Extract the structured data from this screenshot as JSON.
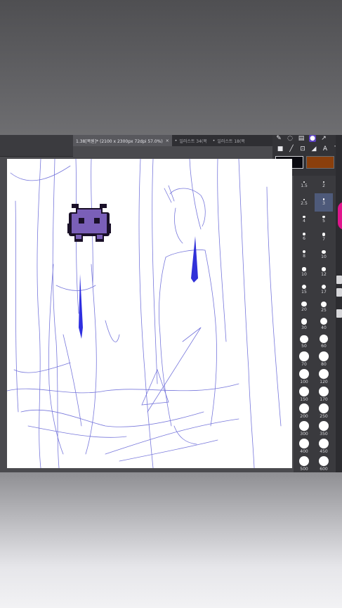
{
  "tabs": [
    {
      "label": "1.38[복원]* (2100 x 2300px 72dpi 57.0%)",
      "active": true,
      "close": "×"
    },
    {
      "label": "일러스트 34(복",
      "active": false,
      "dot": "•"
    },
    {
      "label": "일러스트 18(복",
      "active": false,
      "dot": "•"
    }
  ],
  "tools": {
    "row1": [
      "pen-tool-icon",
      "lasso-tool-icon",
      "layer-tool-icon",
      "selected-tool-icon",
      "share-icon"
    ],
    "row2_glyphs": [
      "■",
      "╱",
      "⊡",
      "◢",
      "A",
      "T"
    ]
  },
  "colors": {
    "main": "#0a0a10",
    "sub": "#8a3f0c",
    "sketch": "#3b3bd0",
    "creature": "#7a5fb8",
    "accent": "#e0158c"
  },
  "brush_sizes": [
    [
      "1.5",
      "2"
    ],
    [
      "2.5",
      "3"
    ],
    [
      "4",
      "5"
    ],
    [
      "6",
      "7"
    ],
    [
      "8",
      "10"
    ],
    [
      "10",
      "12"
    ],
    [
      "15",
      "17"
    ],
    [
      "20",
      "25"
    ],
    [
      "30",
      "40"
    ],
    [
      "50",
      "60"
    ],
    [
      "70",
      "80"
    ],
    [
      "100",
      "120"
    ],
    [
      "150",
      "170"
    ],
    [
      "200",
      "250"
    ],
    [
      "300",
      "350"
    ],
    [
      "400",
      "450"
    ],
    [
      "500",
      "600"
    ]
  ],
  "brush_selected": "3"
}
